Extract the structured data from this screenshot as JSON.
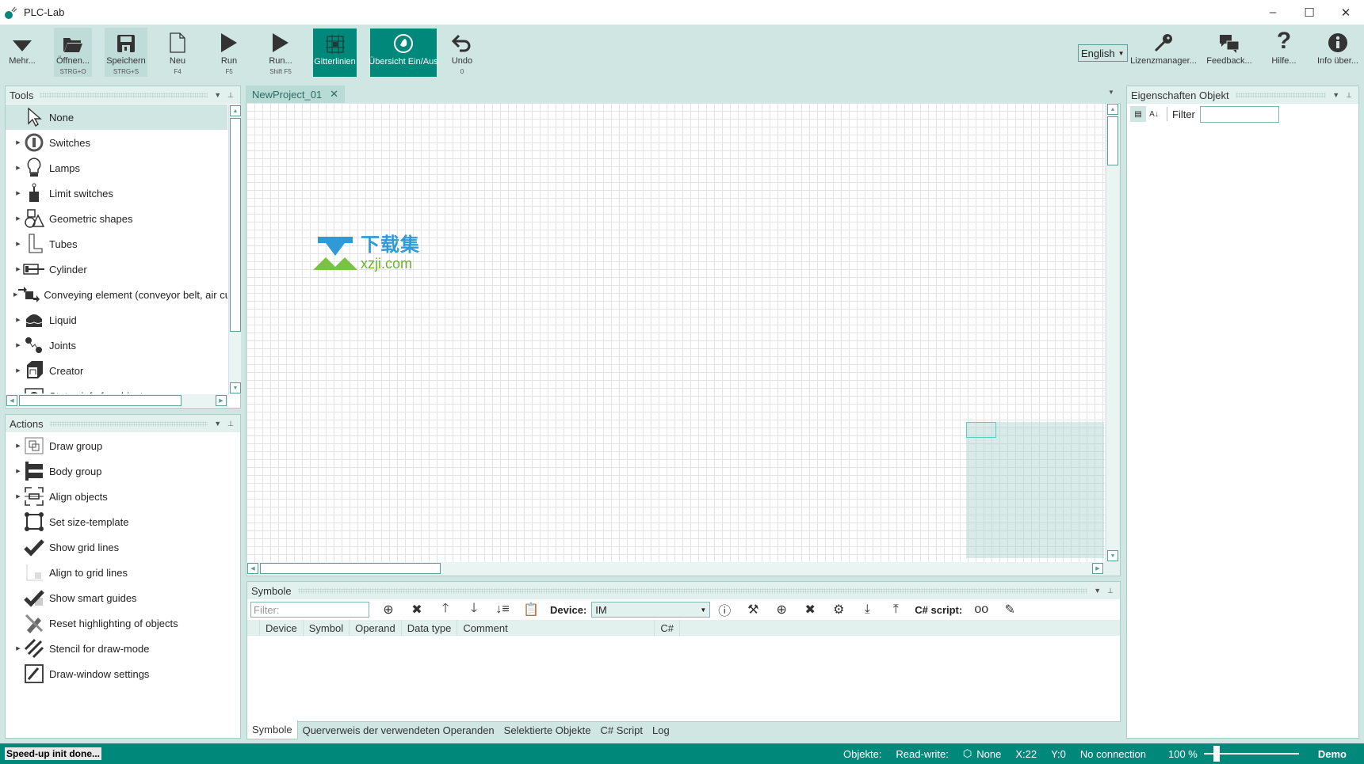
{
  "window": {
    "title": "PLC-Lab",
    "controls": {
      "minimize": "–",
      "maximize": "☐",
      "close": "✕"
    }
  },
  "ribbon": {
    "buttons": [
      {
        "id": "more",
        "label": "Mehr...",
        "shortcut": "",
        "icon": "triangle-down-icon",
        "state": "normal"
      },
      {
        "id": "open",
        "label": "Öffnen...",
        "shortcut": "STRG+O",
        "icon": "folder-open-icon",
        "state": "shaded"
      },
      {
        "id": "save",
        "label": "Speichern",
        "shortcut": "STRG+S",
        "icon": "save-icon",
        "state": "shaded"
      },
      {
        "id": "new",
        "label": "Neu",
        "shortcut": "F4",
        "icon": "new-file-icon",
        "state": "normal"
      },
      {
        "id": "run",
        "label": "Run",
        "shortcut": "F5",
        "icon": "play-icon",
        "state": "normal"
      },
      {
        "id": "run-dialog",
        "label": "Run...",
        "shortcut": "Shift F5",
        "icon": "play-icon",
        "state": "normal"
      },
      {
        "id": "gridlines",
        "label": "Gitterlinien",
        "shortcut": "",
        "icon": "grid-icon",
        "state": "active"
      },
      {
        "id": "overview",
        "label": "Übersicht Ein/Aus",
        "shortcut": "",
        "icon": "overview-hand-icon",
        "state": "active"
      },
      {
        "id": "undo",
        "label": "Undo",
        "shortcut": "0",
        "icon": "undo-icon",
        "state": "normal"
      }
    ],
    "language": {
      "selected": "English"
    },
    "right_buttons": [
      {
        "id": "license",
        "label": "Lizenzmanager...",
        "icon": "key-icon"
      },
      {
        "id": "feedback",
        "label": "Feedback...",
        "icon": "chat-icon"
      },
      {
        "id": "help",
        "label": "Hilfe...",
        "icon": "question-icon"
      },
      {
        "id": "about",
        "label": "Info über...",
        "icon": "info-icon"
      }
    ]
  },
  "tools_panel": {
    "title": "Tools",
    "items": [
      {
        "label": "None",
        "icon": "cursor-icon",
        "expandable": false,
        "selected": true
      },
      {
        "label": "Switches",
        "icon": "switch-icon",
        "expandable": true
      },
      {
        "label": "Lamps",
        "icon": "lamp-icon",
        "expandable": true
      },
      {
        "label": "Limit switches",
        "icon": "limit-switch-icon",
        "expandable": true
      },
      {
        "label": "Geometric shapes",
        "icon": "shapes-icon",
        "expandable": true
      },
      {
        "label": "Tubes",
        "icon": "tube-icon",
        "expandable": true
      },
      {
        "label": "Cylinder",
        "icon": "cylinder-icon",
        "expandable": true
      },
      {
        "label": "Conveying element (conveyor belt, air cu",
        "icon": "conveyor-icon",
        "expandable": true
      },
      {
        "label": "Liquid",
        "icon": "liquid-icon",
        "expandable": true
      },
      {
        "label": "Joints",
        "icon": "joint-icon",
        "expandable": true
      },
      {
        "label": "Creator",
        "icon": "creator-icon",
        "expandable": true
      },
      {
        "label": "Status info for objects",
        "icon": "status-info-icon",
        "expandable": true
      }
    ]
  },
  "actions_panel": {
    "title": "Actions",
    "items": [
      {
        "label": "Draw group",
        "icon": "draw-group-icon",
        "expandable": true
      },
      {
        "label": "Body group",
        "icon": "body-group-icon",
        "expandable": true
      },
      {
        "label": "Align objects",
        "icon": "align-icon",
        "expandable": true
      },
      {
        "label": "Set size-template",
        "icon": "size-template-icon",
        "expandable": false
      },
      {
        "label": "Show grid lines",
        "icon": "check-grid-icon",
        "expandable": false
      },
      {
        "label": "Align to grid lines",
        "icon": "align-grid-icon",
        "expandable": false
      },
      {
        "label": "Show smart guides",
        "icon": "check-guides-icon",
        "expandable": false
      },
      {
        "label": "Reset highlighting of objects",
        "icon": "highlighter-off-icon",
        "expandable": false
      },
      {
        "label": "Stencil for draw-mode",
        "icon": "stencil-icon",
        "expandable": true
      },
      {
        "label": "Draw-window settings",
        "icon": "brush-settings-icon",
        "expandable": false
      }
    ]
  },
  "document": {
    "tab_label": "NewProject_01",
    "tab_close": "✕",
    "watermark": {
      "cn": "下载集",
      "en": "xzji.com"
    }
  },
  "properties_panel": {
    "title": "Eigenschaften Objekt",
    "filter_label": "Filter",
    "filter_value": ""
  },
  "symbols_panel": {
    "title": "Symbole",
    "filter_placeholder": "Filter:",
    "device_label": "Device:",
    "device_value": "IM",
    "script_label": "C# script:",
    "columns": [
      "Device",
      "Symbol",
      "Operand",
      "Data type",
      "Comment",
      "C#"
    ],
    "rows": []
  },
  "bottom_tabs": [
    "Symbole",
    "Querverweis der verwendeten Operanden",
    "Selektierte Objekte",
    "C# Script",
    "Log"
  ],
  "status": {
    "message": "Speed-up init done...",
    "objects_label": "Objekte:",
    "rw_label": "Read-write:",
    "rw_value": "None",
    "x": "X:22",
    "y": "Y:0",
    "connection": "No connection",
    "zoom": "100 %",
    "zoom_slider_fraction": 0.1,
    "license_mode": "Demo"
  },
  "colors": {
    "accent": "#00897b",
    "ribbon_bg": "#cfe6e3",
    "panel_header": "#e2f0ee"
  }
}
